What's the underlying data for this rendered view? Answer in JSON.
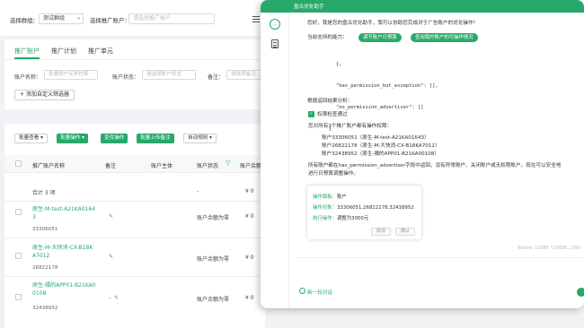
{
  "topbar": {
    "group_label": "选择群组：",
    "group_value": "测试群组",
    "account_label": "选择推广账户：",
    "account_placeholder": "请选择推广账户"
  },
  "tabs": [
    "推广账户",
    "推广计划",
    "推广单元"
  ],
  "filters": {
    "name_label": "账户名称：",
    "name_placeholder": "批量账户名称检索",
    "status_label": "账户状态：",
    "status_placeholder": "请选择账户状态",
    "note_label": "备注：",
    "note_placeholder": "请选择备注",
    "add_filter": "添加自定义筛选器"
  },
  "toolbar": {
    "batch_view": "批量查看",
    "batch_ops": "批量操作",
    "optimize": "变优操作",
    "batch_upload_note": "批量上传备注",
    "auto_rules": "自动规则"
  },
  "table": {
    "headers": [
      "推广账户名称",
      "备注",
      "账户主体",
      "账户状态",
      "账户余额"
    ],
    "summary": {
      "label": "合计 3 项",
      "status": "-",
      "balance": "¥ 0"
    },
    "rows": [
      {
        "name": "原生-M-test-A21KA0164 3",
        "id": "33306051",
        "status": "账户余额为零",
        "balance": "¥ 0"
      },
      {
        "name": "原生-M-大快消-CX-B18K A7012",
        "id": "26822178",
        "status": "账户余额为零",
        "balance": "¥ 0"
      },
      {
        "name": "原生-嬛的APP01-B21KA0 0108",
        "id": "32438952",
        "status": "账户余额为零",
        "balance": "¥ 0"
      }
    ],
    "row3_note": "-"
  },
  "assistant": {
    "title": "盘古优化助手",
    "greeting": "您好，我是您的盘古优化助手，我可以协助您完成对于广告账户的优化操作！",
    "capabilities_label": "当前支持的能力：",
    "capabilities": [
      "调节账户日预算",
      "查询我的账户的可操作情况"
    ],
    "code_lines": [
      "},",
      "\"has_permission_but_exception\": [],",
      "\"no_permission_advertiser\": []",
      "}"
    ],
    "analysis_label": "根据返回结果分析：",
    "check_label": "权限检查通过",
    "accounts_label": "您对所有3个推广账户都有操作权限：",
    "accounts": [
      "账户33306051（原生-M-test-A21KA01643）",
      "账户26822178（原生-M-大快消-CX-B18KA7012）",
      "账户32438952（原生-嬛的APP01-B21KA00108）"
    ],
    "conclusion_1": "所有账户都在has_permission_advertiser字段中返回，没有异常账户、关闭账户或无权限账户。现在可以安全地",
    "conclusion_2": "进行日预算调整操作。",
    "card": {
      "op_object_label": "操作面板：",
      "op_object_value": "账户",
      "targets_label": "操作对象：",
      "targets_value": "33306051,26822178,32438952",
      "action_label": "执行操作：",
      "action_value": "调整为3000元",
      "cancel": "取消",
      "confirm": "确认"
    },
    "tokens": "Tokens: 11085 ↑10686 ↓399",
    "new_chat": "新一轮对话"
  }
}
